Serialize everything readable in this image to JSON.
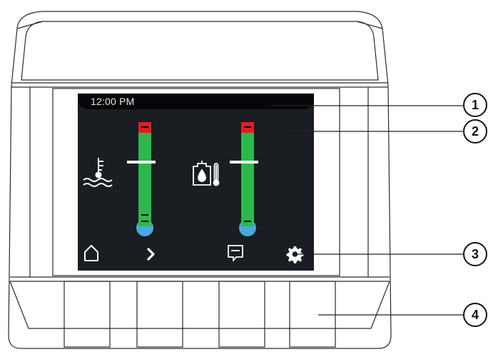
{
  "status_bar": {
    "time": "12:00 PM"
  },
  "gauges": [
    {
      "name": "coolant-temperature",
      "icon": "coolant-temperature-icon"
    },
    {
      "name": "hydraulic-oil-temperature",
      "icon": "oil-temperature-icon"
    }
  ],
  "nav_bar": {
    "icons": [
      "home-icon",
      "chevron-right-icon",
      "message-icon",
      "gear-icon"
    ]
  },
  "buttons": {
    "count": 4
  },
  "callouts": [
    {
      "number": "1"
    },
    {
      "number": "2"
    },
    {
      "number": "3"
    },
    {
      "number": "4"
    }
  ],
  "colors": {
    "screen_bg": "#1a1d22",
    "gauge_green": "#2db84d",
    "gauge_red": "#e01c24",
    "gauge_bulb_blue": "#4aa8e0"
  }
}
